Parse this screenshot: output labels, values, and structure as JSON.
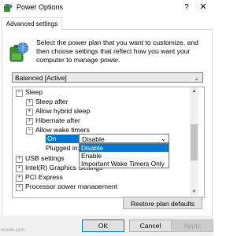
{
  "window": {
    "title": "Power Options",
    "help_glyph": "?",
    "close_glyph": "✕"
  },
  "tab": {
    "label": "Advanced settings"
  },
  "description": "Select the power plan that you want to customize, and then choose settings that reflect how you want your computer to manage power.",
  "plan_select": {
    "value": "Balanced [Active]"
  },
  "tree": {
    "sleep": {
      "label": "Sleep",
      "expander": "−"
    },
    "sleep_after": "Sleep after",
    "hybrid_sleep": "Allow hybrid sleep",
    "hibernate_after": "Hibernate after",
    "wake_timers": {
      "label": "Allow wake timers",
      "expander": "−"
    },
    "on_battery_label": "On battery:",
    "plugged_in_label": "Plugged in:",
    "usb_settings": "USB settings",
    "graphics_settings": "Intel(R) Graphics Settings",
    "pci_express": "PCI Express",
    "processor_power": "Processor power management"
  },
  "wake_timer_dropdown": {
    "current": "Disable",
    "options": [
      "Disable",
      "Enable",
      "Important Wake Timers Only"
    ],
    "selected_index": 0
  },
  "buttons": {
    "restore": "Restore plan defaults",
    "ok": "OK",
    "cancel": "Cancel",
    "apply": "Apply"
  },
  "watermark": "wsxdn.com",
  "colors": {
    "accent": "#0078d7",
    "footer_bg": "#f0f0f0"
  },
  "icons": {
    "app": "power-options-icon",
    "plan": "battery-globe-icon"
  }
}
